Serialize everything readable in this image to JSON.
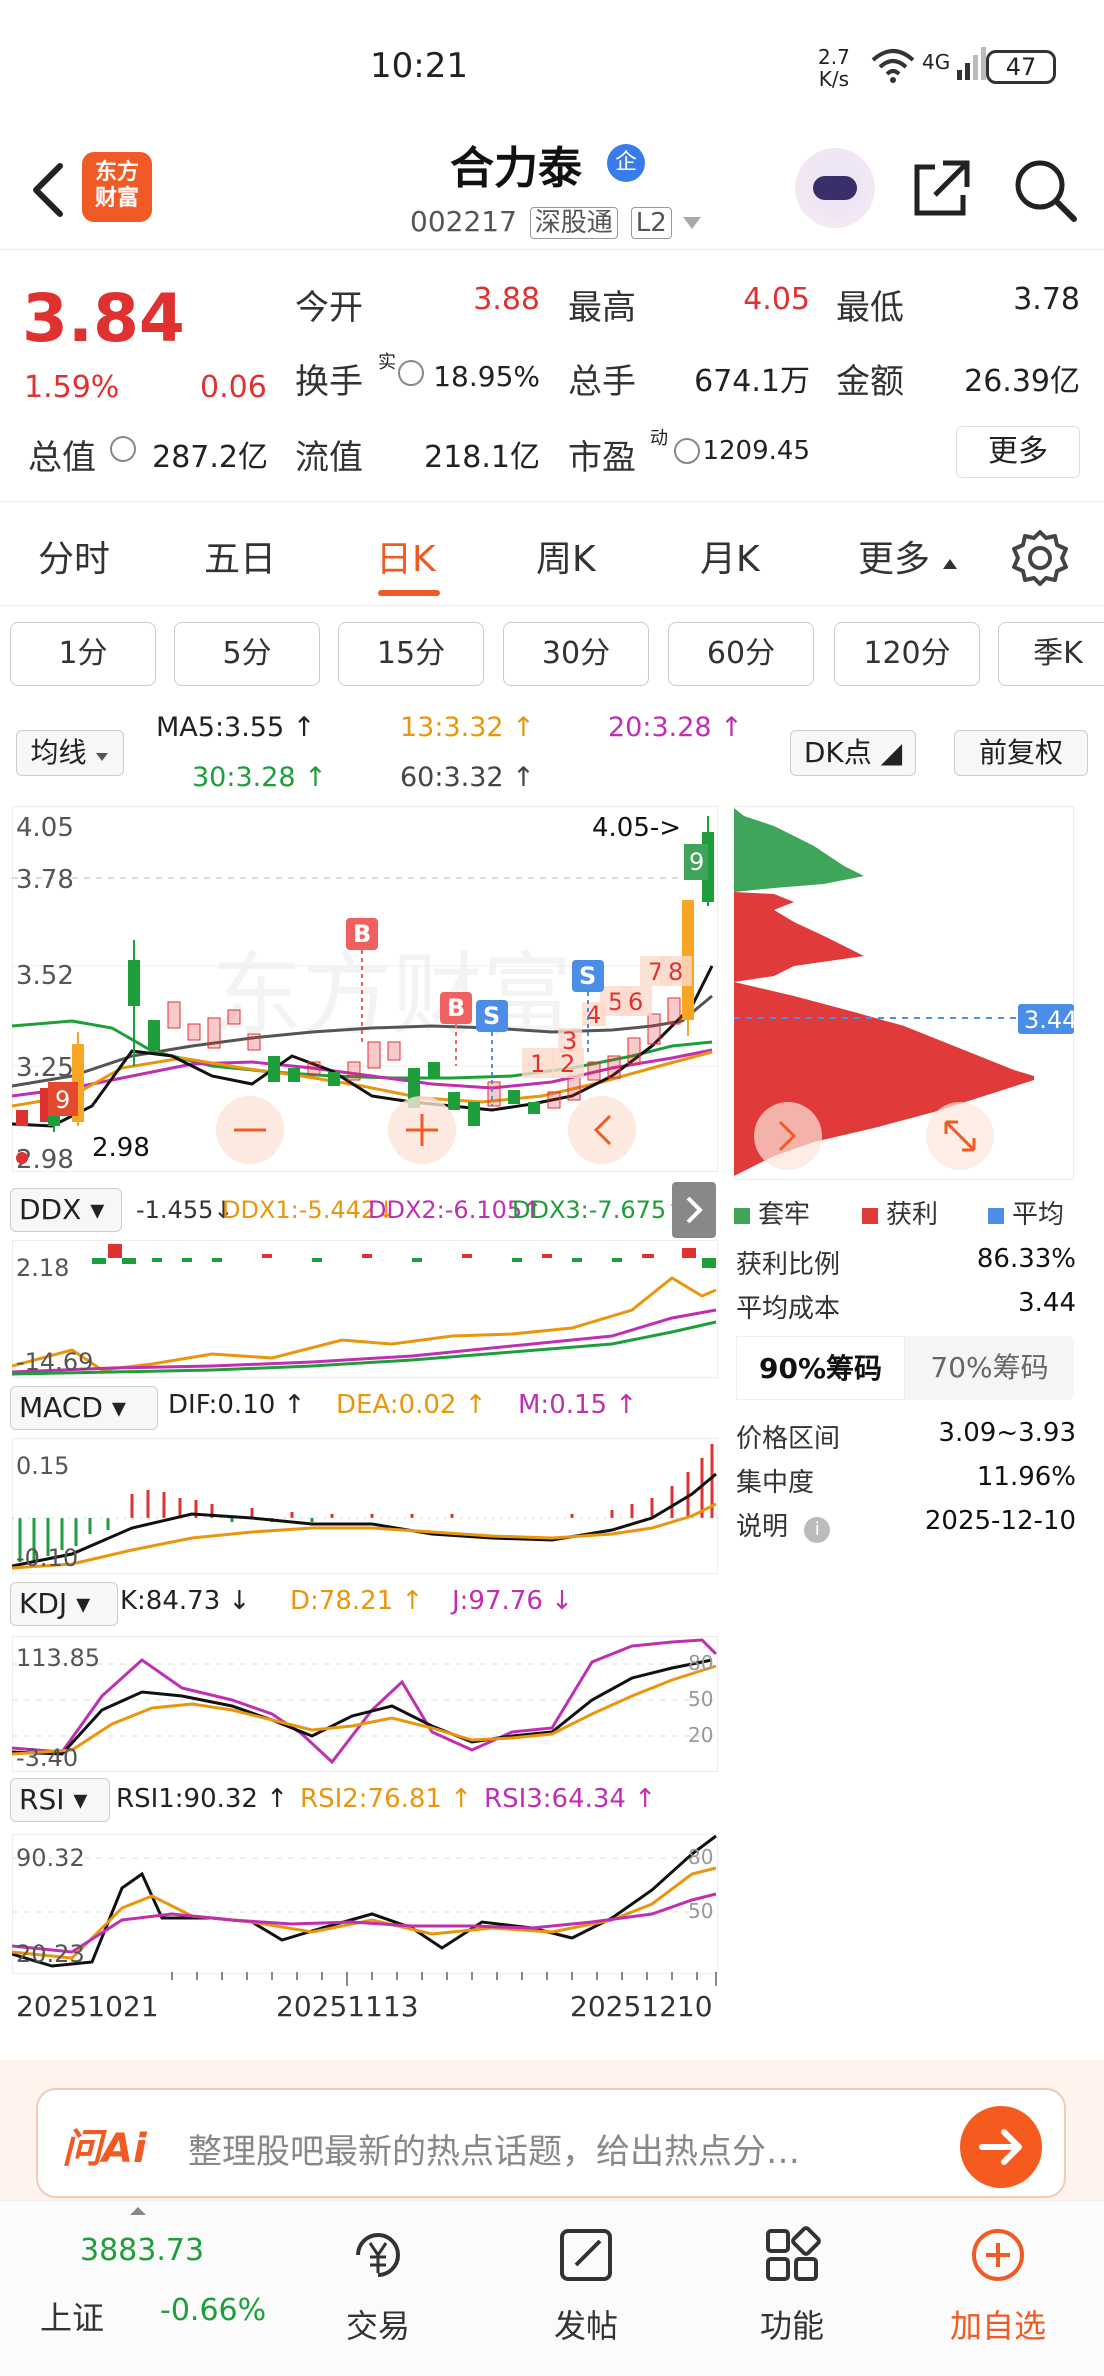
{
  "status_bar": {
    "time": "10:21",
    "net_speed": "2.7",
    "net_speed_unit": "K/s",
    "signal": "4G",
    "battery": "47"
  },
  "header": {
    "brand_lines": [
      "东方",
      "财富"
    ],
    "stock_name": "合力泰",
    "qi_badge": "企",
    "stock_code": "002217",
    "tag_connect": "深股通",
    "tag_level": "L2"
  },
  "quote": {
    "price": "3.84",
    "change_pct": "1.59%",
    "change": "0.06",
    "open_label": "今开",
    "open": "3.88",
    "high_label": "最高",
    "high": "4.05",
    "low_label": "最低",
    "low": "3.78",
    "turnover_label": "换手",
    "turnover_sup": "实",
    "turnover": "18.95%",
    "volume_label": "总手",
    "volume": "674.1万",
    "amount_label": "金额",
    "amount": "26.39亿",
    "mktcap_label": "总值",
    "mktcap": "287.2亿",
    "float_label": "流值",
    "float": "218.1亿",
    "pe_label": "市盈",
    "pe_sup": "动",
    "pe": "1209.45",
    "more": "更多"
  },
  "tabs": [
    "分时",
    "五日",
    "日K",
    "周K",
    "月K",
    "更多"
  ],
  "active_tab": "日K",
  "periods": [
    "1分",
    "5分",
    "15分",
    "30分",
    "60分",
    "120分",
    "季K"
  ],
  "ma": {
    "selector": "均线",
    "ma5": "MA5:3.55",
    "ma13": "13:3.32",
    "ma20": "20:3.28",
    "ma30": "30:3.28",
    "ma60": "60:3.32",
    "dk_button": "DK点",
    "adjust_button": "前复权"
  },
  "kline": {
    "axis": [
      "4.05",
      "3.78",
      "3.52",
      "3.25",
      "2.98"
    ],
    "high_marker": "4.05->",
    "low_marker": "2.98",
    "signal_labels": [
      "B",
      "B",
      "S",
      "S"
    ],
    "wave_labels": [
      "1",
      "2",
      "3",
      "4",
      "5",
      "6",
      "7",
      "8",
      "9",
      "9"
    ]
  },
  "chip_panel": {
    "avg_price_tag": "3.44",
    "legend": [
      "套牢",
      "获利",
      "平均"
    ],
    "stats": [
      {
        "label": "获利比例",
        "value": "86.33%"
      },
      {
        "label": "平均成本",
        "value": "3.44"
      }
    ],
    "chip_tabs": [
      "90%筹码",
      "70%筹码"
    ],
    "active_chip_tab": "90%筹码",
    "details": [
      {
        "label": "价格区间",
        "value": "3.09~3.93"
      },
      {
        "label": "集中度",
        "value": "11.96%"
      },
      {
        "label": "说明",
        "value": "2025-12-10"
      }
    ]
  },
  "ddx": {
    "name": "DDX",
    "value": "-1.455",
    "ddx1": "DDX1:-5.442",
    "ddx2": "DDX2:-6.105",
    "ddx3": "DDX3:-7.675",
    "axis": [
      "2.18",
      "-14.69"
    ]
  },
  "macd": {
    "name": "MACD",
    "dif": "DIF:0.10",
    "dea": "DEA:0.02",
    "m": "M:0.15",
    "axis": [
      "0.15",
      "-0.10"
    ]
  },
  "kdj": {
    "name": "KDJ",
    "k": "K:84.73",
    "d": "D:78.21",
    "j": "J:97.76",
    "axis": [
      "113.85",
      "-3.40"
    ],
    "levels": [
      "80",
      "50",
      "20"
    ]
  },
  "rsi": {
    "name": "RSI",
    "rsi1": "RSI1:90.32",
    "rsi2": "RSI2:76.81",
    "rsi3": "RSI3:64.34",
    "axis": [
      "90.32",
      "20.23"
    ],
    "levels": [
      "80",
      "50"
    ]
  },
  "dates": [
    "20251021",
    "20251113",
    "20251210"
  ],
  "ai_bar": {
    "logo": "问Ai",
    "placeholder": "整理股吧最新的热点话题，给出热点分…"
  },
  "bottom_nav": {
    "index_value": "3883.73",
    "index_name": "上证",
    "index_change": "-0.66%",
    "items": [
      "交易",
      "发帖",
      "功能",
      "加自选"
    ]
  },
  "colors": {
    "up": "#e03131",
    "down": "#1e9e3a",
    "accent": "#f05a24",
    "ma13": "#e8960e",
    "ma20": "#c02fb0"
  }
}
